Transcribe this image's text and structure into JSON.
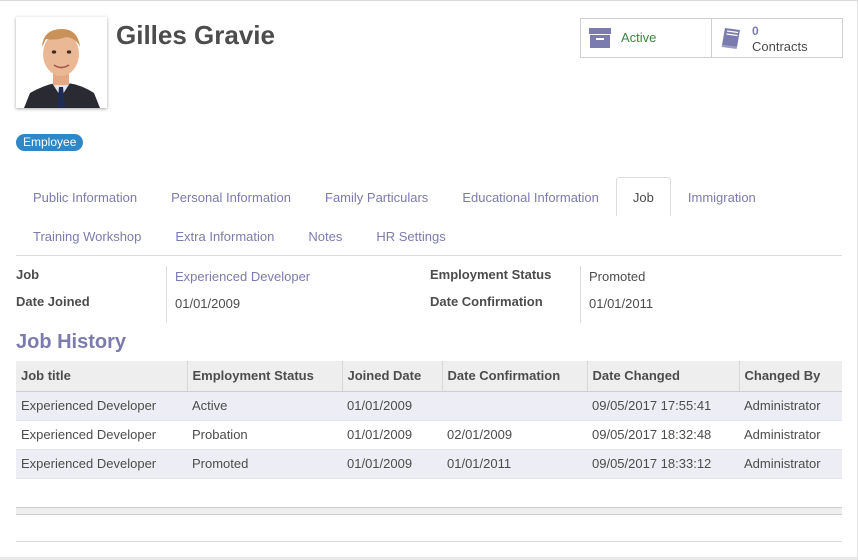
{
  "employee": {
    "name": "Gilles Gravie",
    "tag": "Employee"
  },
  "stats": {
    "active_label": "Active",
    "contracts_count": "0",
    "contracts_label": "Contracts",
    "archive_icon": "archive-icon",
    "book_icon": "book-icon"
  },
  "tabs": {
    "row1": [
      "Public Information",
      "Personal Information",
      "Family Particulars",
      "Educational Information",
      "Job",
      "Immigration"
    ],
    "row2": [
      "Training Workshop",
      "Extra Information",
      "Notes",
      "HR Settings"
    ],
    "active": "Job"
  },
  "job": {
    "job_label": "Job",
    "job_value": "Experienced Developer",
    "date_joined_label": "Date Joined",
    "date_joined_value": "01/01/2009",
    "employment_status_label": "Employment Status",
    "employment_status_value": "Promoted",
    "date_confirmation_label": "Date Confirmation",
    "date_confirmation_value": "01/01/2011"
  },
  "history": {
    "title": "Job History",
    "columns": [
      "Job title",
      "Employment Status",
      "Joined Date",
      "Date Confirmation",
      "Date Changed",
      "Changed By"
    ],
    "rows": [
      [
        "Experienced Developer",
        "Active",
        "01/01/2009",
        "",
        "09/05/2017 17:55:41",
        "Administrator"
      ],
      [
        "Experienced Developer",
        "Probation",
        "01/01/2009",
        "02/01/2009",
        "09/05/2017 18:32:48",
        "Administrator"
      ],
      [
        "Experienced Developer",
        "Promoted",
        "01/01/2009",
        "01/01/2011",
        "09/05/2017 18:33:12",
        "Administrator"
      ]
    ]
  },
  "colors": {
    "accent": "#7c7bad",
    "active_green": "#39883c",
    "tag_blue": "#2f88c5",
    "row_alt": "#ededf5"
  }
}
